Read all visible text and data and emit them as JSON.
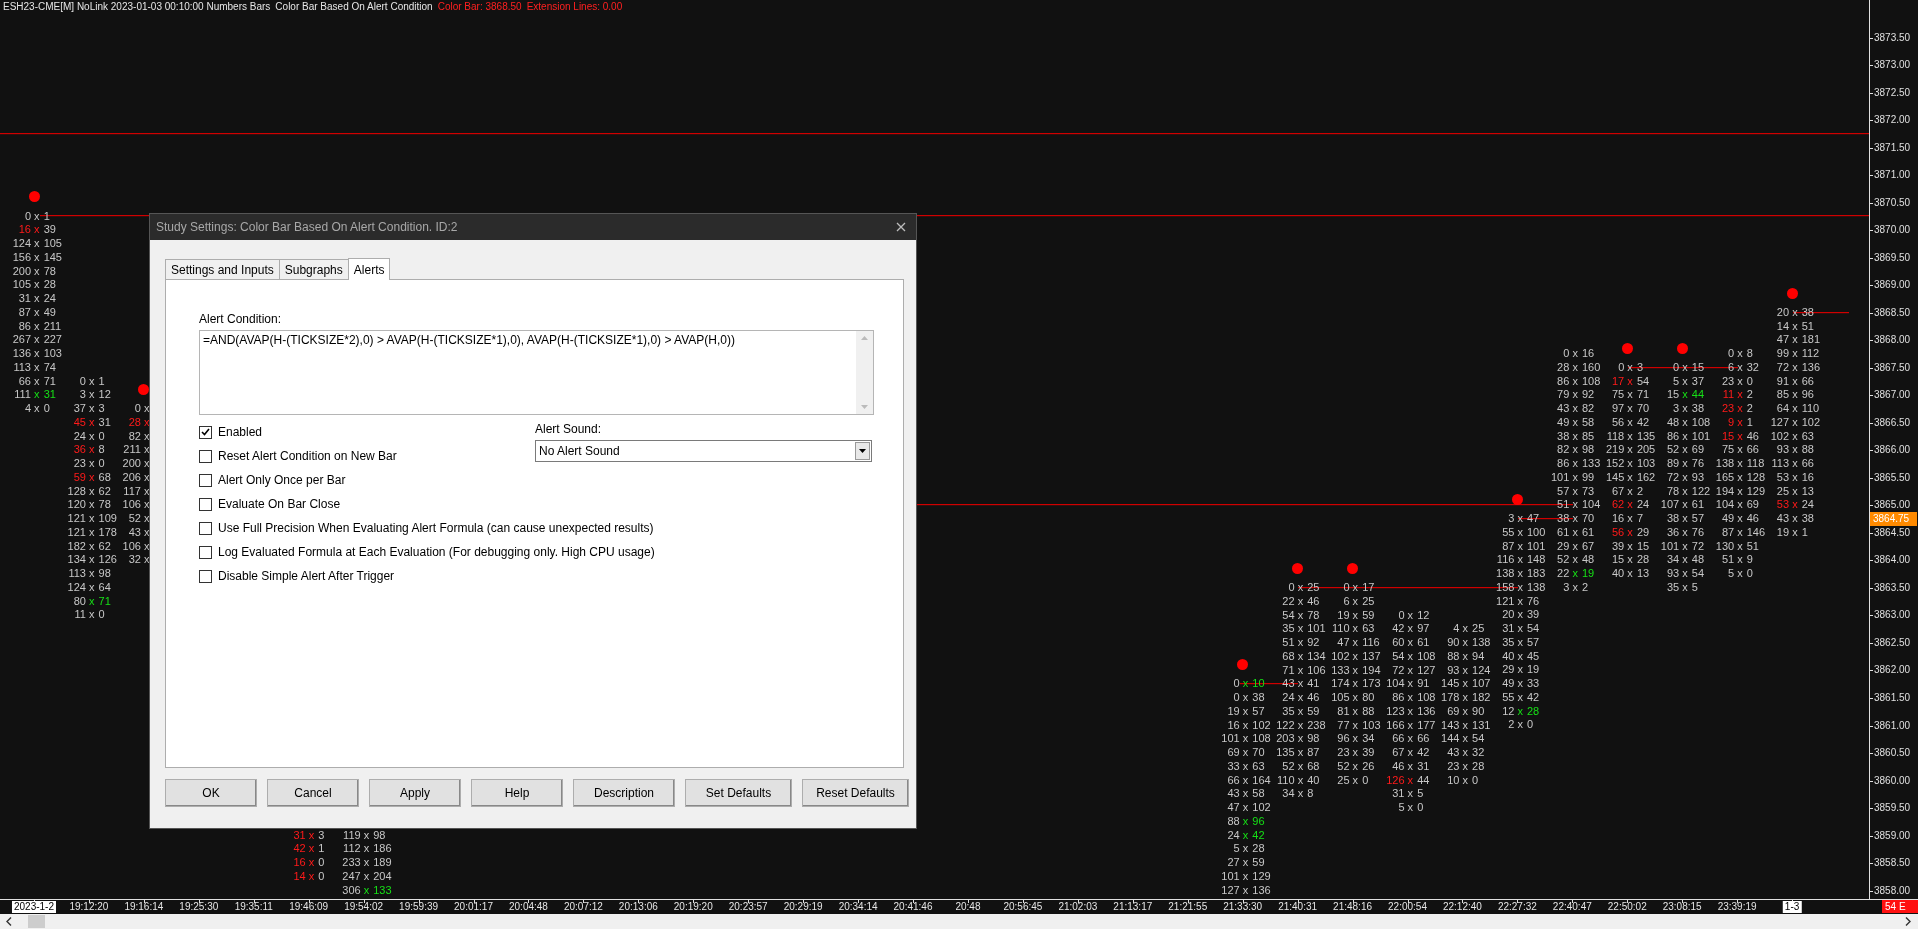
{
  "header": {
    "chart_info": "ESH23-CME[M] NoLink 2023-01-03 00:10:00 Numbers Bars",
    "study_name": "Color Bar Based On Alert Condition",
    "values": [
      "Color Bar: 3868.50",
      "Extension Lines: 0.00"
    ]
  },
  "bars": [
    {
      "alert": true,
      "rows": [
        {
          "bid": "0",
          "x": "x",
          "ask": "1",
          "kind": "plain"
        },
        {
          "bid": "16",
          "x": "x",
          "ask": "39",
          "kind": "bid"
        },
        {
          "bid": "124",
          "x": "x",
          "ask": "105",
          "kind": "plain"
        },
        {
          "bid": "156",
          "x": "x",
          "ask": "145",
          "kind": "plain"
        },
        {
          "bid": "200",
          "x": "x",
          "ask": "78",
          "kind": "plain"
        },
        {
          "bid": "105",
          "x": "x",
          "ask": "28",
          "kind": "plain"
        },
        {
          "bid": "31",
          "x": "x",
          "ask": "24",
          "kind": "plain"
        },
        {
          "bid": "87",
          "x": "x",
          "ask": "49",
          "kind": "plain"
        },
        {
          "bid": "86",
          "x": "x",
          "ask": "211",
          "kind": "plain"
        },
        {
          "bid": "267",
          "x": "x",
          "ask": "227",
          "kind": "plain"
        },
        {
          "bid": "136",
          "x": "x",
          "ask": "103",
          "kind": "plain"
        },
        {
          "bid": "113",
          "x": "x",
          "ask": "74",
          "kind": "plain"
        },
        {
          "bid": "66",
          "x": "x",
          "ask": "71",
          "kind": "plain"
        },
        {
          "bid": "111",
          "x": "x",
          "ask": "31",
          "kind": "ask"
        },
        {
          "bid": "4",
          "x": "x",
          "ask": "0",
          "kind": "plain"
        }
      ]
    },
    {
      "alert": false,
      "rows": [
        {
          "bid": "0",
          "x": "x",
          "ask": "1",
          "kind": "plain"
        },
        {
          "bid": "3",
          "x": "x",
          "ask": "12",
          "kind": "plain"
        },
        {
          "bid": "37",
          "x": "x",
          "ask": "3",
          "kind": "plain"
        },
        {
          "bid": "45",
          "x": "x",
          "ask": "31",
          "kind": "bid"
        },
        {
          "bid": "24",
          "x": "x",
          "ask": "0",
          "kind": "plain"
        },
        {
          "bid": "36",
          "x": "x",
          "ask": "8",
          "kind": "bid"
        },
        {
          "bid": "23",
          "x": "x",
          "ask": "0",
          "kind": "plain"
        },
        {
          "bid": "59",
          "x": "x",
          "ask": "68",
          "kind": "bid"
        },
        {
          "bid": "128",
          "x": "x",
          "ask": "62",
          "kind": "plain"
        },
        {
          "bid": "120",
          "x": "x",
          "ask": "78",
          "kind": "plain"
        },
        {
          "bid": "121",
          "x": "x",
          "ask": "109",
          "kind": "plain"
        },
        {
          "bid": "121",
          "x": "x",
          "ask": "178",
          "kind": "plain"
        },
        {
          "bid": "182",
          "x": "x",
          "ask": "62",
          "kind": "plain"
        },
        {
          "bid": "134",
          "x": "x",
          "ask": "126",
          "kind": "plain"
        },
        {
          "bid": "113",
          "x": "x",
          "ask": "98",
          "kind": "plain"
        },
        {
          "bid": "124",
          "x": "x",
          "ask": "64",
          "kind": "plain"
        },
        {
          "bid": "80",
          "x": "x",
          "ask": "71",
          "kind": "ask"
        },
        {
          "bid": "11",
          "x": "x",
          "ask": "0",
          "kind": "plain"
        }
      ]
    },
    {
      "alert": true,
      "rows": [
        {
          "bid": "0",
          "x": "x",
          "kind": "plain"
        },
        {
          "bid": "28",
          "x": "x",
          "kind": "bid"
        },
        {
          "bid": "82",
          "x": "x",
          "kind": "plain"
        },
        {
          "bid": "211",
          "x": "x",
          "kind": "plain"
        },
        {
          "bid": "200",
          "x": "x",
          "kind": "plain"
        },
        {
          "bid": "206",
          "x": "x",
          "kind": "plain"
        },
        {
          "bid": "117",
          "x": "x",
          "kind": "plain"
        },
        {
          "bid": "106",
          "x": "x",
          "kind": "plain"
        },
        {
          "bid": "52",
          "x": "x",
          "kind": "plain"
        },
        {
          "bid": "43",
          "x": "x",
          "kind": "plain"
        },
        {
          "bid": "106",
          "x": "x",
          "kind": "plain"
        },
        {
          "bid": "32",
          "x": "x",
          "kind": "plain"
        }
      ]
    },
    {
      "alert": false,
      "rows": [
        {
          "bid": "31",
          "x": "x",
          "ask": "3",
          "kind": "bid"
        },
        {
          "bid": "42",
          "x": "x",
          "ask": "1",
          "kind": "bid"
        },
        {
          "bid": "16",
          "x": "x",
          "ask": "0",
          "kind": "bid"
        },
        {
          "bid": "14",
          "x": "x",
          "ask": "0",
          "kind": "bid"
        }
      ]
    },
    {
      "alert": false,
      "rows": [
        {
          "bid": "119",
          "x": "x",
          "ask": "98",
          "kind": "plain"
        },
        {
          "bid": "112",
          "x": "x",
          "ask": "186",
          "kind": "plain"
        },
        {
          "bid": "233",
          "x": "x",
          "ask": "189",
          "kind": "plain"
        },
        {
          "bid": "247",
          "x": "x",
          "ask": "204",
          "kind": "plain"
        },
        {
          "bid": "306",
          "x": "x",
          "ask": "133",
          "kind": "ask"
        }
      ]
    },
    {
      "alert": true,
      "rows": [
        {
          "bid": "0",
          "x": "x",
          "ask": "10",
          "kind": "ask"
        },
        {
          "bid": "0",
          "x": "x",
          "ask": "38",
          "kind": "plain"
        },
        {
          "bid": "19",
          "x": "x",
          "ask": "57",
          "kind": "plain"
        },
        {
          "bid": "16",
          "x": "x",
          "ask": "102",
          "kind": "plain"
        },
        {
          "bid": "101",
          "x": "x",
          "ask": "108",
          "kind": "plain"
        },
        {
          "bid": "69",
          "x": "x",
          "ask": "70",
          "kind": "plain"
        },
        {
          "bid": "33",
          "x": "x",
          "ask": "63",
          "kind": "plain"
        },
        {
          "bid": "66",
          "x": "x",
          "ask": "164",
          "kind": "plain"
        },
        {
          "bid": "43",
          "x": "x",
          "ask": "58",
          "kind": "plain"
        },
        {
          "bid": "47",
          "x": "x",
          "ask": "102",
          "kind": "plain"
        },
        {
          "bid": "88",
          "x": "x",
          "ask": "96",
          "kind": "ask"
        },
        {
          "bid": "24",
          "x": "x",
          "ask": "42",
          "kind": "ask"
        },
        {
          "bid": "5",
          "x": "x",
          "ask": "28",
          "kind": "plain"
        },
        {
          "bid": "27",
          "x": "x",
          "ask": "59",
          "kind": "plain"
        },
        {
          "bid": "101",
          "x": "x",
          "ask": "129",
          "kind": "plain"
        },
        {
          "bid": "127",
          "x": "x",
          "ask": "136",
          "kind": "plain"
        }
      ]
    },
    {
      "alert": true,
      "rows": [
        {
          "bid": "0",
          "x": "x",
          "ask": "25",
          "kind": "plain"
        },
        {
          "bid": "22",
          "x": "x",
          "ask": "46",
          "kind": "plain"
        },
        {
          "bid": "54",
          "x": "x",
          "ask": "78",
          "kind": "plain"
        },
        {
          "bid": "35",
          "x": "x",
          "ask": "101",
          "kind": "plain"
        },
        {
          "bid": "51",
          "x": "x",
          "ask": "92",
          "kind": "plain"
        },
        {
          "bid": "68",
          "x": "x",
          "ask": "134",
          "kind": "plain"
        },
        {
          "bid": "71",
          "x": "x",
          "ask": "106",
          "kind": "plain"
        },
        {
          "bid": "43",
          "x": "x",
          "ask": "41",
          "kind": "plain"
        },
        {
          "bid": "24",
          "x": "x",
          "ask": "46",
          "kind": "plain"
        },
        {
          "bid": "35",
          "x": "x",
          "ask": "59",
          "kind": "plain"
        },
        {
          "bid": "122",
          "x": "x",
          "ask": "238",
          "kind": "plain"
        },
        {
          "bid": "203",
          "x": "x",
          "ask": "98",
          "kind": "plain"
        },
        {
          "bid": "135",
          "x": "x",
          "ask": "87",
          "kind": "plain"
        },
        {
          "bid": "52",
          "x": "x",
          "ask": "68",
          "kind": "plain"
        },
        {
          "bid": "110",
          "x": "x",
          "ask": "40",
          "kind": "plain"
        },
        {
          "bid": "34",
          "x": "x",
          "ask": "8",
          "kind": "plain"
        }
      ]
    },
    {
      "alert": true,
      "rows": [
        {
          "bid": "0",
          "x": "x",
          "ask": "17",
          "kind": "plain"
        },
        {
          "bid": "6",
          "x": "x",
          "ask": "25",
          "kind": "plain"
        },
        {
          "bid": "19",
          "x": "x",
          "ask": "59",
          "kind": "plain"
        },
        {
          "bid": "110",
          "x": "x",
          "ask": "63",
          "kind": "plain"
        },
        {
          "bid": "47",
          "x": "x",
          "ask": "116",
          "kind": "plain"
        },
        {
          "bid": "102",
          "x": "x",
          "ask": "137",
          "kind": "plain"
        },
        {
          "bid": "133",
          "x": "x",
          "ask": "194",
          "kind": "plain"
        },
        {
          "bid": "174",
          "x": "x",
          "ask": "173",
          "kind": "plain"
        },
        {
          "bid": "105",
          "x": "x",
          "ask": "80",
          "kind": "plain"
        },
        {
          "bid": "81",
          "x": "x",
          "ask": "88",
          "kind": "plain"
        },
        {
          "bid": "77",
          "x": "x",
          "ask": "103",
          "kind": "plain"
        },
        {
          "bid": "96",
          "x": "x",
          "ask": "34",
          "kind": "plain"
        },
        {
          "bid": "23",
          "x": "x",
          "ask": "39",
          "kind": "plain"
        },
        {
          "bid": "52",
          "x": "x",
          "ask": "26",
          "kind": "plain"
        },
        {
          "bid": "25",
          "x": "x",
          "ask": "0",
          "kind": "plain"
        }
      ]
    },
    {
      "alert": false,
      "rows": [
        {
          "bid": "0",
          "x": "x",
          "ask": "12",
          "kind": "plain"
        },
        {
          "bid": "42",
          "x": "x",
          "ask": "97",
          "kind": "plain"
        },
        {
          "bid": "60",
          "x": "x",
          "ask": "61",
          "kind": "plain"
        },
        {
          "bid": "54",
          "x": "x",
          "ask": "108",
          "kind": "plain"
        },
        {
          "bid": "72",
          "x": "x",
          "ask": "127",
          "kind": "plain"
        },
        {
          "bid": "104",
          "x": "x",
          "ask": "91",
          "kind": "plain"
        },
        {
          "bid": "86",
          "x": "x",
          "ask": "108",
          "kind": "plain"
        },
        {
          "bid": "123",
          "x": "x",
          "ask": "136",
          "kind": "plain"
        },
        {
          "bid": "166",
          "x": "x",
          "ask": "177",
          "kind": "plain"
        },
        {
          "bid": "66",
          "x": "x",
          "ask": "66",
          "kind": "plain"
        },
        {
          "bid": "67",
          "x": "x",
          "ask": "42",
          "kind": "plain"
        },
        {
          "bid": "46",
          "x": "x",
          "ask": "31",
          "kind": "plain"
        },
        {
          "bid": "126",
          "x": "x",
          "ask": "44",
          "kind": "bid"
        },
        {
          "bid": "31",
          "x": "x",
          "ask": "5",
          "kind": "plain"
        },
        {
          "bid": "5",
          "x": "x",
          "ask": "0",
          "kind": "plain"
        }
      ]
    },
    {
      "alert": false,
      "rows": [
        {
          "bid": "4",
          "x": "x",
          "ask": "25",
          "kind": "plain"
        },
        {
          "bid": "90",
          "x": "x",
          "ask": "138",
          "kind": "plain"
        },
        {
          "bid": "88",
          "x": "x",
          "ask": "94",
          "kind": "plain"
        },
        {
          "bid": "93",
          "x": "x",
          "ask": "124",
          "kind": "plain"
        },
        {
          "bid": "145",
          "x": "x",
          "ask": "107",
          "kind": "plain"
        },
        {
          "bid": "178",
          "x": "x",
          "ask": "182",
          "kind": "plain"
        },
        {
          "bid": "69",
          "x": "x",
          "ask": "90",
          "kind": "plain"
        },
        {
          "bid": "143",
          "x": "x",
          "ask": "131",
          "kind": "plain"
        },
        {
          "bid": "144",
          "x": "x",
          "ask": "54",
          "kind": "plain"
        },
        {
          "bid": "43",
          "x": "x",
          "ask": "32",
          "kind": "plain"
        },
        {
          "bid": "23",
          "x": "x",
          "ask": "28",
          "kind": "plain"
        },
        {
          "bid": "10",
          "x": "x",
          "ask": "0",
          "kind": "plain"
        }
      ]
    },
    {
      "alert": true,
      "rows": [
        {
          "bid": "3",
          "x": "x",
          "ask": "47",
          "kind": "plain"
        },
        {
          "bid": "55",
          "x": "x",
          "ask": "100",
          "kind": "plain"
        },
        {
          "bid": "87",
          "x": "x",
          "ask": "101",
          "kind": "plain"
        },
        {
          "bid": "116",
          "x": "x",
          "ask": "148",
          "kind": "plain"
        },
        {
          "bid": "138",
          "x": "x",
          "ask": "183",
          "kind": "plain"
        },
        {
          "bid": "158",
          "x": "x",
          "ask": "138",
          "kind": "plain"
        },
        {
          "bid": "121",
          "x": "x",
          "ask": "76",
          "kind": "plain"
        },
        {
          "bid": "20",
          "x": "x",
          "ask": "39",
          "kind": "plain"
        },
        {
          "bid": "31",
          "x": "x",
          "ask": "54",
          "kind": "plain"
        },
        {
          "bid": "35",
          "x": "x",
          "ask": "57",
          "kind": "plain"
        },
        {
          "bid": "40",
          "x": "x",
          "ask": "45",
          "kind": "plain"
        },
        {
          "bid": "29",
          "x": "x",
          "ask": "19",
          "kind": "plain"
        },
        {
          "bid": "49",
          "x": "x",
          "ask": "33",
          "kind": "plain"
        },
        {
          "bid": "55",
          "x": "x",
          "ask": "42",
          "kind": "plain"
        },
        {
          "bid": "12",
          "x": "x",
          "ask": "28",
          "kind": "ask"
        },
        {
          "bid": "2",
          "x": "x",
          "ask": "0",
          "kind": "plain"
        }
      ]
    },
    {
      "alert": false,
      "rows": [
        {
          "bid": "0",
          "x": "x",
          "ask": "16",
          "kind": "plain"
        },
        {
          "bid": "28",
          "x": "x",
          "ask": "160",
          "kind": "plain"
        },
        {
          "bid": "86",
          "x": "x",
          "ask": "108",
          "kind": "plain"
        },
        {
          "bid": "79",
          "x": "x",
          "ask": "92",
          "kind": "plain"
        },
        {
          "bid": "43",
          "x": "x",
          "ask": "82",
          "kind": "plain"
        },
        {
          "bid": "49",
          "x": "x",
          "ask": "58",
          "kind": "plain"
        },
        {
          "bid": "38",
          "x": "x",
          "ask": "85",
          "kind": "plain"
        },
        {
          "bid": "82",
          "x": "x",
          "ask": "98",
          "kind": "plain"
        },
        {
          "bid": "86",
          "x": "x",
          "ask": "133",
          "kind": "plain"
        },
        {
          "bid": "101",
          "x": "x",
          "ask": "99",
          "kind": "plain"
        },
        {
          "bid": "57",
          "x": "x",
          "ask": "73",
          "kind": "plain"
        },
        {
          "bid": "51",
          "x": "x",
          "ask": "104",
          "kind": "plain"
        },
        {
          "bid": "38",
          "x": "x",
          "ask": "70",
          "kind": "plain"
        },
        {
          "bid": "61",
          "x": "x",
          "ask": "61",
          "kind": "plain"
        },
        {
          "bid": "29",
          "x": "x",
          "ask": "67",
          "kind": "plain"
        },
        {
          "bid": "52",
          "x": "x",
          "ask": "48",
          "kind": "plain"
        },
        {
          "bid": "22",
          "x": "x",
          "ask": "19",
          "kind": "ask"
        },
        {
          "bid": "3",
          "x": "x",
          "ask": "2",
          "kind": "plain"
        }
      ]
    },
    {
      "alert": true,
      "rows": [
        {
          "bid": "0",
          "x": "x",
          "ask": "3",
          "kind": "plain"
        },
        {
          "bid": "17",
          "x": "x",
          "ask": "54",
          "kind": "bid"
        },
        {
          "bid": "75",
          "x": "x",
          "ask": "71",
          "kind": "plain"
        },
        {
          "bid": "97",
          "x": "x",
          "ask": "70",
          "kind": "plain"
        },
        {
          "bid": "56",
          "x": "x",
          "ask": "42",
          "kind": "plain"
        },
        {
          "bid": "118",
          "x": "x",
          "ask": "135",
          "kind": "plain"
        },
        {
          "bid": "219",
          "x": "x",
          "ask": "205",
          "kind": "plain"
        },
        {
          "bid": "152",
          "x": "x",
          "ask": "103",
          "kind": "plain"
        },
        {
          "bid": "145",
          "x": "x",
          "ask": "162",
          "kind": "plain"
        },
        {
          "bid": "67",
          "x": "x",
          "ask": "2",
          "kind": "plain"
        },
        {
          "bid": "62",
          "x": "x",
          "ask": "24",
          "kind": "bid"
        },
        {
          "bid": "16",
          "x": "x",
          "ask": "7",
          "kind": "plain"
        },
        {
          "bid": "56",
          "x": "x",
          "ask": "29",
          "kind": "bid"
        },
        {
          "bid": "39",
          "x": "x",
          "ask": "15",
          "kind": "plain"
        },
        {
          "bid": "15",
          "x": "x",
          "ask": "28",
          "kind": "plain"
        },
        {
          "bid": "40",
          "x": "x",
          "ask": "13",
          "kind": "plain"
        }
      ]
    },
    {
      "alert": true,
      "rows": [
        {
          "bid": "0",
          "x": "x",
          "ask": "15",
          "kind": "plain"
        },
        {
          "bid": "5",
          "x": "x",
          "ask": "37",
          "kind": "plain"
        },
        {
          "bid": "15",
          "x": "x",
          "ask": "44",
          "kind": "ask"
        },
        {
          "bid": "3",
          "x": "x",
          "ask": "38",
          "kind": "plain"
        },
        {
          "bid": "48",
          "x": "x",
          "ask": "108",
          "kind": "plain"
        },
        {
          "bid": "86",
          "x": "x",
          "ask": "101",
          "kind": "plain"
        },
        {
          "bid": "52",
          "x": "x",
          "ask": "69",
          "kind": "plain"
        },
        {
          "bid": "89",
          "x": "x",
          "ask": "76",
          "kind": "plain"
        },
        {
          "bid": "72",
          "x": "x",
          "ask": "93",
          "kind": "plain"
        },
        {
          "bid": "78",
          "x": "x",
          "ask": "122",
          "kind": "plain"
        },
        {
          "bid": "107",
          "x": "x",
          "ask": "61",
          "kind": "plain"
        },
        {
          "bid": "38",
          "x": "x",
          "ask": "57",
          "kind": "plain"
        },
        {
          "bid": "36",
          "x": "x",
          "ask": "76",
          "kind": "plain"
        },
        {
          "bid": "101",
          "x": "x",
          "ask": "72",
          "kind": "plain"
        },
        {
          "bid": "34",
          "x": "x",
          "ask": "48",
          "kind": "plain"
        },
        {
          "bid": "93",
          "x": "x",
          "ask": "54",
          "kind": "plain"
        },
        {
          "bid": "35",
          "x": "x",
          "ask": "5",
          "kind": "plain"
        }
      ]
    },
    {
      "alert": false,
      "rows": [
        {
          "bid": "0",
          "x": "x",
          "ask": "8",
          "kind": "plain"
        },
        {
          "bid": "6",
          "x": "x",
          "ask": "32",
          "kind": "plain"
        },
        {
          "bid": "23",
          "x": "x",
          "ask": "0",
          "kind": "plain"
        },
        {
          "bid": "11",
          "x": "x",
          "ask": "2",
          "kind": "bid"
        },
        {
          "bid": "23",
          "x": "x",
          "ask": "2",
          "kind": "bid"
        },
        {
          "bid": "9",
          "x": "x",
          "ask": "1",
          "kind": "bid"
        },
        {
          "bid": "15",
          "x": "x",
          "ask": "46",
          "kind": "bid"
        },
        {
          "bid": "75",
          "x": "x",
          "ask": "66",
          "kind": "plain"
        },
        {
          "bid": "138",
          "x": "x",
          "ask": "118",
          "kind": "plain"
        },
        {
          "bid": "165",
          "x": "x",
          "ask": "128",
          "kind": "plain"
        },
        {
          "bid": "194",
          "x": "x",
          "ask": "129",
          "kind": "plain"
        },
        {
          "bid": "104",
          "x": "x",
          "ask": "69",
          "kind": "plain"
        },
        {
          "bid": "49",
          "x": "x",
          "ask": "46",
          "kind": "plain"
        },
        {
          "bid": "87",
          "x": "x",
          "ask": "146",
          "kind": "plain"
        },
        {
          "bid": "130",
          "x": "x",
          "ask": "51",
          "kind": "plain"
        },
        {
          "bid": "51",
          "x": "x",
          "ask": "9",
          "kind": "plain"
        },
        {
          "bid": "5",
          "x": "x",
          "ask": "0",
          "kind": "plain"
        }
      ]
    },
    {
      "alert": true,
      "rows": [
        {
          "bid": "20",
          "x": "x",
          "ask": "38",
          "kind": "plain"
        },
        {
          "bid": "14",
          "x": "x",
          "ask": "51",
          "kind": "plain"
        },
        {
          "bid": "47",
          "x": "x",
          "ask": "181",
          "kind": "plain"
        },
        {
          "bid": "99",
          "x": "x",
          "ask": "112",
          "kind": "plain"
        },
        {
          "bid": "72",
          "x": "x",
          "ask": "136",
          "kind": "plain"
        },
        {
          "bid": "91",
          "x": "x",
          "ask": "66",
          "kind": "plain"
        },
        {
          "bid": "85",
          "x": "x",
          "ask": "96",
          "kind": "plain"
        },
        {
          "bid": "64",
          "x": "x",
          "ask": "110",
          "kind": "plain"
        },
        {
          "bid": "127",
          "x": "x",
          "ask": "102",
          "kind": "plain"
        },
        {
          "bid": "102",
          "x": "x",
          "ask": "63",
          "kind": "plain"
        },
        {
          "bid": "93",
          "x": "x",
          "ask": "88",
          "kind": "plain"
        },
        {
          "bid": "113",
          "x": "x",
          "ask": "66",
          "kind": "plain"
        },
        {
          "bid": "53",
          "x": "x",
          "ask": "16",
          "kind": "plain"
        },
        {
          "bid": "25",
          "x": "x",
          "ask": "13",
          "kind": "plain"
        },
        {
          "bid": "53",
          "x": "x",
          "ask": "24",
          "kind": "bid"
        },
        {
          "bid": "43",
          "x": "x",
          "ask": "38",
          "kind": "plain"
        },
        {
          "bid": "19",
          "x": "x",
          "ask": "1",
          "kind": "plain"
        }
      ]
    }
  ],
  "price_axis": {
    "labels": [
      "3873.50",
      "3873.00",
      "3872.50",
      "3872.00",
      "3871.50",
      "3871.00",
      "3870.50",
      "3870.00",
      "3869.50",
      "3869.00",
      "3868.50",
      "3868.00",
      "3867.50",
      "3867.00",
      "3866.50",
      "3866.00",
      "3865.50",
      "3865.00",
      "3864.50",
      "3864.00",
      "3863.50",
      "3863.00",
      "3862.50",
      "3862.00",
      "3861.50",
      "3861.00",
      "3860.50",
      "3860.00",
      "3859.50",
      "3859.00",
      "3858.50",
      "3858.00"
    ],
    "current_price": "3864.75"
  },
  "time_axis": {
    "labels": [
      {
        "text": "2023-1-2",
        "kind": "date"
      },
      {
        "text": "19:12:20",
        "kind": "time"
      },
      {
        "text": "19:16:14",
        "kind": "time"
      },
      {
        "text": "19:25:30",
        "kind": "time"
      },
      {
        "text": "19:35:11",
        "kind": "time"
      },
      {
        "text": "19:46:09",
        "kind": "time"
      },
      {
        "text": "19:54:02",
        "kind": "time"
      },
      {
        "text": "19:59:39",
        "kind": "time"
      },
      {
        "text": "20:01:17",
        "kind": "time"
      },
      {
        "text": "20:04:48",
        "kind": "time"
      },
      {
        "text": "20:07:12",
        "kind": "time"
      },
      {
        "text": "20:13:06",
        "kind": "time"
      },
      {
        "text": "20:19:20",
        "kind": "time"
      },
      {
        "text": "20:23:57",
        "kind": "time"
      },
      {
        "text": "20:29:19",
        "kind": "time"
      },
      {
        "text": "20:34:14",
        "kind": "time"
      },
      {
        "text": "20:41:46",
        "kind": "time"
      },
      {
        "text": "20:48",
        "kind": "time"
      },
      {
        "text": "20:56:45",
        "kind": "time"
      },
      {
        "text": "21:02:03",
        "kind": "time"
      },
      {
        "text": "21:13:17",
        "kind": "time"
      },
      {
        "text": "21:21:55",
        "kind": "time"
      },
      {
        "text": "21:33:30",
        "kind": "time"
      },
      {
        "text": "21:40:31",
        "kind": "time"
      },
      {
        "text": "21:48:16",
        "kind": "time"
      },
      {
        "text": "22:00:54",
        "kind": "time"
      },
      {
        "text": "22:12:40",
        "kind": "time"
      },
      {
        "text": "22:27:32",
        "kind": "time"
      },
      {
        "text": "22:40:47",
        "kind": "time"
      },
      {
        "text": "22:50:02",
        "kind": "time"
      },
      {
        "text": "23:08:15",
        "kind": "time"
      },
      {
        "text": "23:39:19",
        "kind": "time"
      },
      {
        "text": "1-3",
        "kind": "date"
      }
    ],
    "bar_timer": "54 E"
  },
  "dialog": {
    "title": "Study Settings: Color Bar Based On Alert Condition. ID:2",
    "tabs": [
      {
        "label": "Settings and Inputs",
        "selected": false
      },
      {
        "label": "Subgraphs",
        "selected": false
      },
      {
        "label": "Alerts",
        "selected": true
      }
    ],
    "alert_condition": {
      "label": "Alert Condition:",
      "value": "=AND(AVAP(H-(TICKSIZE*2),0) > AVAP(H-(TICKSIZE*1),0), AVAP(H-(TICKSIZE*1),0) > AVAP(H,0))"
    },
    "options": [
      {
        "label": "Enabled",
        "checked": true
      },
      {
        "label": "Reset Alert Condition on New Bar",
        "checked": false
      },
      {
        "label": "Alert Only Once per Bar",
        "checked": false
      },
      {
        "label": "Evaluate On Bar Close",
        "checked": false
      },
      {
        "label": "Use Full Precision When Evaluating Alert Formula (can cause unexpected results)",
        "checked": false
      },
      {
        "label": "Log Evaluated Formula at Each Evaluation (For debugging only. High CPU usage)",
        "checked": false
      },
      {
        "label": "Disable Simple Alert After Trigger",
        "checked": false
      }
    ],
    "alert_sound": {
      "label": "Alert Sound:",
      "value": "No Alert Sound"
    },
    "buttons": [
      "OK",
      "Cancel",
      "Apply",
      "Help",
      "Description",
      "Set Defaults",
      "Reset Defaults"
    ]
  }
}
